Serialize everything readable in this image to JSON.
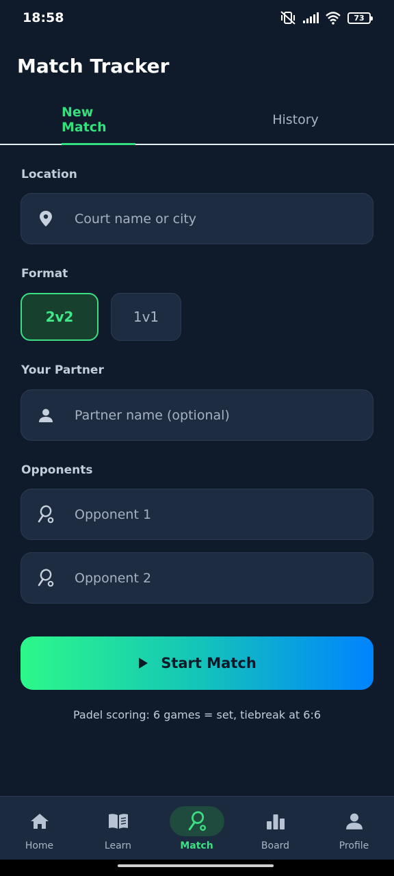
{
  "status": {
    "time": "18:58",
    "battery": "73"
  },
  "app": {
    "title": "Match Tracker"
  },
  "tabs": [
    {
      "label": "New Match",
      "active": true
    },
    {
      "label": "History",
      "active": false
    }
  ],
  "form": {
    "location": {
      "label": "Location",
      "placeholder": "Court name or city",
      "icon": "location-pin-icon"
    },
    "format": {
      "label": "Format",
      "options": [
        "2v2",
        "1v1"
      ],
      "selected": "2v2"
    },
    "partner": {
      "label": "Your Partner",
      "placeholder": "Partner name (optional)",
      "icon": "person-icon"
    },
    "opponents": {
      "label": "Opponents",
      "fields": [
        {
          "placeholder": "Opponent 1",
          "icon": "racket-icon"
        },
        {
          "placeholder": "Opponent 2",
          "icon": "racket-icon"
        }
      ]
    }
  },
  "start_button": {
    "label": "Start Match",
    "icon": "play-icon"
  },
  "hint": "Padel scoring: 6 games = set, tiebreak at 6:6",
  "nav": [
    {
      "label": "Home",
      "icon": "home-icon",
      "active": false
    },
    {
      "label": "Learn",
      "icon": "book-icon",
      "active": false
    },
    {
      "label": "Match",
      "icon": "racket-icon",
      "active": true
    },
    {
      "label": "Board",
      "icon": "bar-chart-icon",
      "active": false
    },
    {
      "label": "Profile",
      "icon": "person-icon",
      "active": false
    }
  ],
  "colors": {
    "background": "#0f1a2b",
    "accent": "#34e07e",
    "field": "#1e2c42",
    "gradient_start": "#2df88a",
    "gradient_end": "#0083ff"
  }
}
